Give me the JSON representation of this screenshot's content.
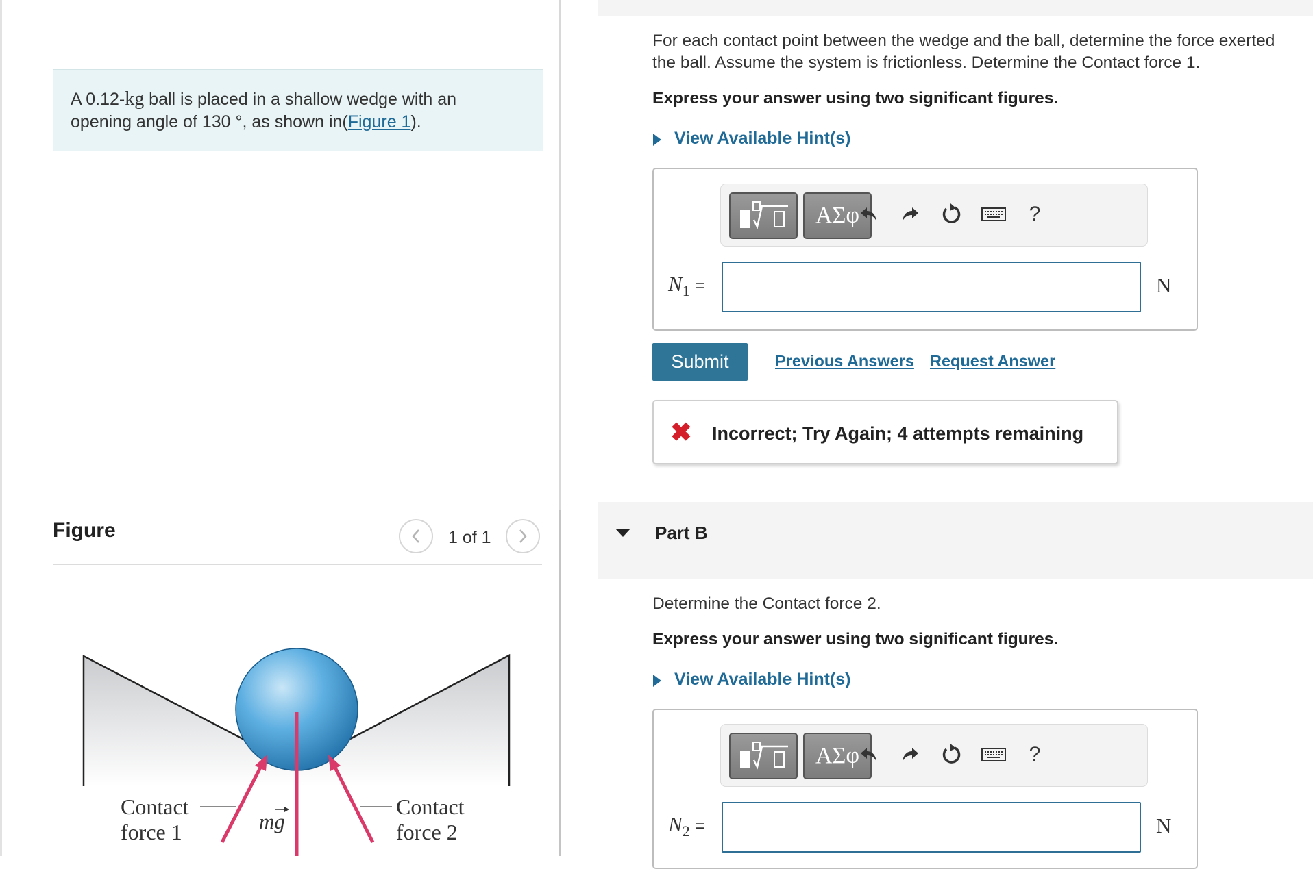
{
  "problem": {
    "text_prefix": "A 0.12-",
    "unit_kg": "kg",
    "text_middle": " ball is placed in a shallow wedge with an opening angle of 130 °, as shown in(",
    "figure_link": "Figure 1",
    "text_suffix": ")."
  },
  "figure": {
    "title": "Figure",
    "page_indicator": "1 of 1",
    "prev_icon": "chevron-left-icon",
    "next_icon": "chevron-right-icon",
    "labels": {
      "contact1_line1": "Contact",
      "contact1_line2": "force 1",
      "mg": "mg",
      "contact2_line1": "Contact",
      "contact2_line2": "force 2"
    },
    "colors": {
      "ball": "#4a9fd6",
      "arrows": "#d93a6a",
      "wedge": "#d3d5d8"
    }
  },
  "partA": {
    "question": "For each contact point between the wedge and the ball, determine the force exerted",
    "question_line2": "the ball. Assume the system is frictionless. Determine the Contact force 1.",
    "sig_figs": "Express your answer using two significant figures.",
    "hint_link": "View Available Hint(s)",
    "toolbar": {
      "template_icon": "sqrt-template-icon",
      "greek_label": "ΑΣφ",
      "undo_icon": "undo-icon",
      "redo_icon": "redo-icon",
      "reset_icon": "reset-icon",
      "keyboard_icon": "keyboard-icon",
      "help_label": "?"
    },
    "var_letter": "N",
    "var_sub": "1",
    "equals": "=",
    "input_value": "",
    "unit": "N",
    "submit_label": "Submit",
    "previous_answers_label": "Previous Answers",
    "request_answer_label": "Request Answer",
    "feedback_icon": "✖",
    "feedback_text": "Incorrect; Try Again; 4 attempts remaining"
  },
  "partB": {
    "title": "Part B",
    "question": "Determine the Contact force 2.",
    "sig_figs": "Express your answer using two significant figures.",
    "hint_link": "View Available Hint(s)",
    "toolbar": {
      "greek_label": "ΑΣφ",
      "help_label": "?"
    },
    "var_letter": "N",
    "var_sub": "2",
    "equals": "=",
    "input_value": "",
    "unit": "N"
  }
}
